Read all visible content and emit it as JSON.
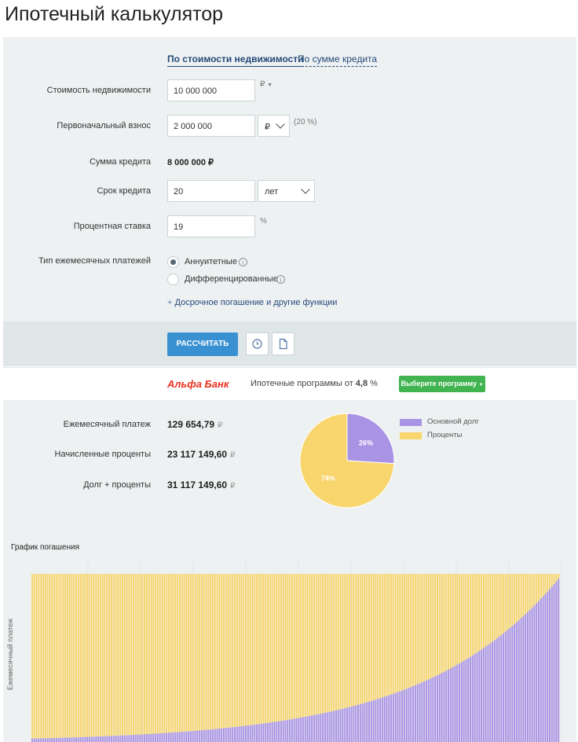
{
  "page": {
    "title": "Ипотечный калькулятор"
  },
  "tabs": {
    "by_price": "По стоимости недвижимости",
    "by_loan": "По сумме кредита"
  },
  "form": {
    "price_label": "Стоимость недвижимости",
    "price_value": "10 000 000",
    "price_unit": "₽",
    "down_label": "Первоначальный взнос",
    "down_value": "2 000 000",
    "down_unit": "₽",
    "down_percent": "(20 %)",
    "loan_label": "Сумма кредита",
    "loan_value": "8 000 000 ₽",
    "term_label": "Срок кредита",
    "term_value": "20",
    "term_unit": "лет",
    "rate_label": "Процентная ставка",
    "rate_value": "19",
    "rate_unit": "%",
    "type_label": "Тип ежемесячных платежей",
    "type_annuity": "Аннуитетные",
    "type_diff": "Дифференцированные",
    "early_link": "Досрочное погашение и другие функции"
  },
  "actions": {
    "calc_label": "РАССЧИТАТЬ"
  },
  "bank": {
    "name": "Альфа Банк",
    "programs_text": "Ипотечные программы от",
    "programs_rate": "4,8",
    "programs_unit": "%",
    "select_label": "Выберите программу"
  },
  "results": {
    "monthly_label": "Ежемесячный платеж",
    "monthly_value": "129 654,79",
    "interest_label": "Начисленные проценты",
    "interest_value": "23 117 149,60",
    "total_label": "Долг + проценты",
    "total_value": "31 117 149,60",
    "currency": "₽"
  },
  "colors": {
    "principal": "#a993e4",
    "interest": "#f8d66d"
  },
  "chart_data": [
    {
      "type": "pie",
      "labels": [
        "Основной долг",
        "Проценты"
      ],
      "values": [
        26,
        74
      ],
      "value_labels": [
        "26%",
        "74%"
      ],
      "legend_placement": "right"
    },
    {
      "type": "bar",
      "title": "График погашения",
      "ylabel": "Ежемесячный платеж",
      "periods": 240,
      "stacked": true,
      "series": [
        {
          "name": "Основной долг",
          "principal_share_start": 0.02,
          "principal_share_end": 0.97
        },
        {
          "name": "Проценты"
        }
      ]
    }
  ]
}
